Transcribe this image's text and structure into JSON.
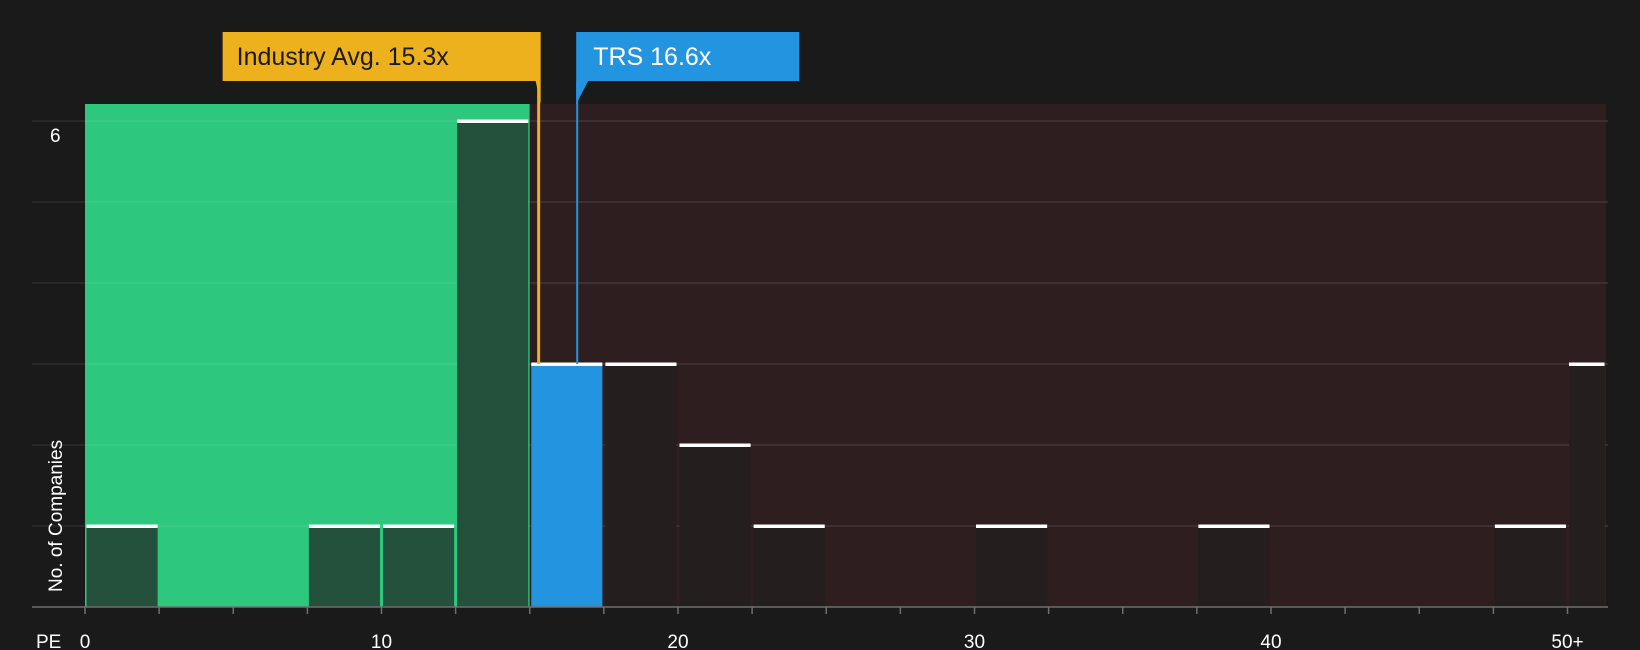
{
  "chart_data": {
    "type": "bar",
    "xlabel": "PE",
    "ylabel": "No. of Companies",
    "ylim": [
      0,
      6
    ],
    "xlim": [
      0,
      51.3
    ],
    "x_ticks": [
      {
        "value": 0,
        "label": "0"
      },
      {
        "value": 10,
        "label": "10"
      },
      {
        "value": 20,
        "label": "20"
      },
      {
        "value": 30,
        "label": "30"
      },
      {
        "value": 40,
        "label": "40"
      },
      {
        "value": 50,
        "label": "50+"
      }
    ],
    "y_ticks": [
      {
        "value": 6,
        "label": "6"
      }
    ],
    "bins": [
      {
        "start": 0,
        "end": 2.5,
        "count": 1
      },
      {
        "start": 7.5,
        "end": 10,
        "count": 1
      },
      {
        "start": 10,
        "end": 12.5,
        "count": 1
      },
      {
        "start": 12.5,
        "end": 15,
        "count": 6
      },
      {
        "start": 15,
        "end": 17.5,
        "count": 3,
        "highlight": true
      },
      {
        "start": 17.5,
        "end": 20,
        "count": 3
      },
      {
        "start": 20,
        "end": 22.5,
        "count": 2
      },
      {
        "start": 22.5,
        "end": 25,
        "count": 1
      },
      {
        "start": 30,
        "end": 32.5,
        "count": 1
      },
      {
        "start": 37.5,
        "end": 40,
        "count": 1
      },
      {
        "start": 47.5,
        "end": 50,
        "count": 1
      },
      {
        "start": 50,
        "end": 51.3,
        "count": 3
      }
    ],
    "zones": [
      {
        "name": "undervalued",
        "start": 0,
        "end": 15,
        "color": "#2ec77e"
      },
      {
        "name": "overvalued",
        "start": 15,
        "end": 51.3,
        "color": "#2e1e1f"
      }
    ],
    "markers": [
      {
        "name": "industry-avg",
        "label": "Industry Avg. 15.3x",
        "value": 15.3,
        "color": "#eeb11e"
      },
      {
        "name": "company",
        "label": "TRS 16.6x",
        "value": 16.6,
        "color": "#2394e0"
      }
    ],
    "colors": {
      "background": "#1a1a1a",
      "bar_in_green": "#23513b",
      "bar_in_red": "#241e1e",
      "bar_highlight": "#2394e0",
      "bar_top": "#ffffff",
      "gridline": "#4a4344",
      "axis": "#6e6e6e",
      "callout_text_dark": "#1a1a1a",
      "callout_text_light": "#ffffff"
    }
  }
}
